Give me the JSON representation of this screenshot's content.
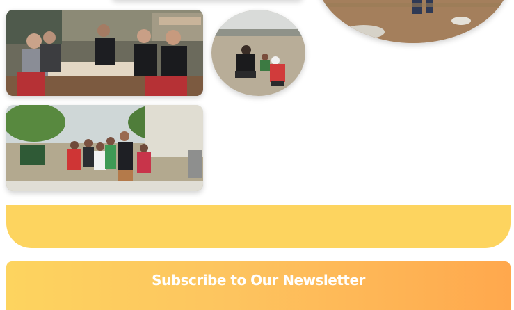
{
  "gallery": {
    "photos": [
      {
        "id": "dinner",
        "alt": "Group seated at an outdoor restaurant table"
      },
      {
        "id": "ball-game",
        "alt": "Volunteers crouching with children on a sandy field"
      },
      {
        "id": "field",
        "alt": "Person standing in a dry grassy field"
      },
      {
        "id": "kids-group",
        "alt": "Group of children posing with adults outdoors"
      }
    ]
  },
  "colors": {
    "yellow": "#fdd45f",
    "orange": "#ffa84d",
    "white": "#ffffff"
  },
  "newsletter": {
    "title": "Subscribe to Our Newsletter"
  }
}
